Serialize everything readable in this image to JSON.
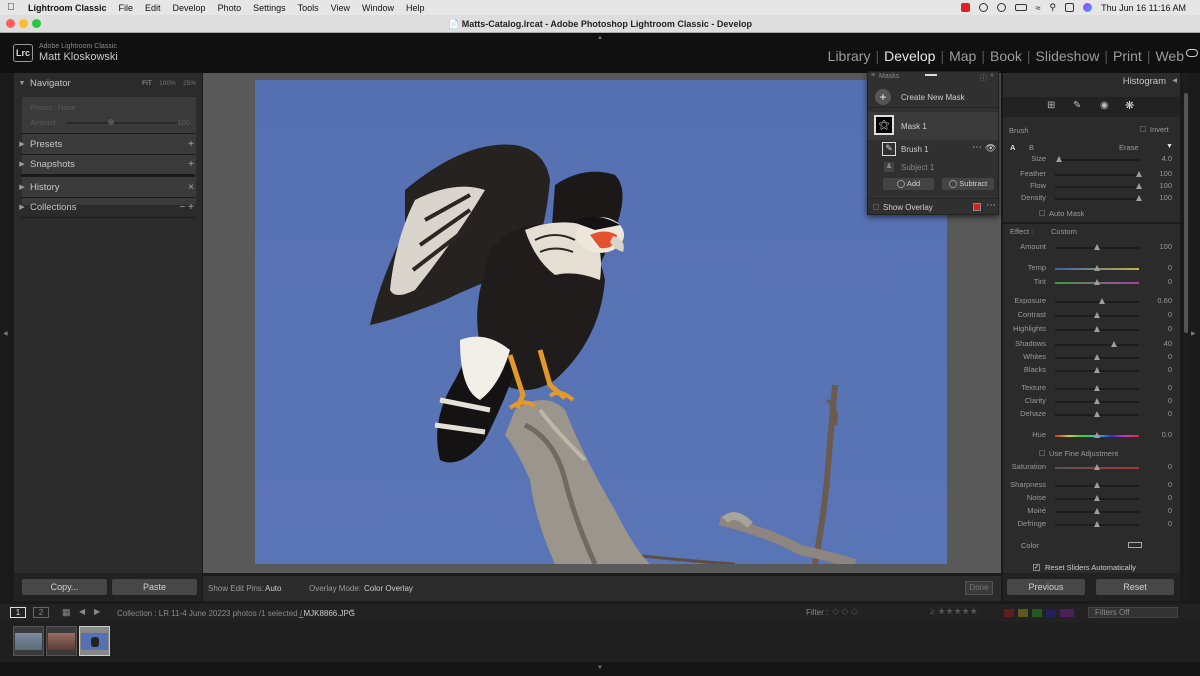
{
  "menubar": {
    "app": "Lightroom Classic",
    "items": [
      "File",
      "Edit",
      "Develop",
      "Photo",
      "Settings",
      "Tools",
      "View",
      "Window",
      "Help"
    ],
    "clock": "Thu Jun 16  11:16 AM"
  },
  "window": {
    "title": "Matts-Catalog.lrcat - Adobe Photoshop Lightroom Classic - Develop"
  },
  "identity": {
    "logo": "Lrc",
    "app_name": "Adobe Lightroom Classic",
    "user": "Matt Kloskowski"
  },
  "modules": [
    "Library",
    "Develop",
    "Map",
    "Book",
    "Slideshow",
    "Print",
    "Web"
  ],
  "active_module": "Develop",
  "left_panel": {
    "navigator": {
      "label": "Navigator",
      "zoom_opts": [
        "FIT",
        "100%",
        "25%"
      ]
    },
    "preset_preview": {
      "name": "Preset : None",
      "amount_label": "Amount",
      "amount_value": "100"
    },
    "sections": [
      {
        "label": "Presets",
        "action": "+"
      },
      {
        "label": "Snapshots",
        "action": "+"
      },
      {
        "label": "History",
        "action": "×"
      },
      {
        "label": "Collections",
        "action": "− +"
      }
    ],
    "copy_label": "Copy...",
    "paste_label": "Paste"
  },
  "masks_panel": {
    "title": "Masks",
    "create_label": "Create New Mask",
    "mask_name": "Mask 1",
    "brush_name": "Brush 1",
    "subject_name": "Subject 1",
    "add_label": "Add",
    "subtract_label": "Subtract",
    "show_overlay_label": "Show Overlay",
    "overlay_color": "#d42020"
  },
  "toolbar": {
    "edit_pins_label": "Show Edit Pins:",
    "edit_pins_value": "Auto",
    "overlay_mode_label": "Overlay Mode:",
    "overlay_mode_value": "Color Overlay",
    "done_label": "Done"
  },
  "right_panel": {
    "histogram_label": "Histogram",
    "brush": {
      "label": "Brush",
      "invert_label": "Invert",
      "tab_a": "A",
      "tab_b": "B",
      "erase_label": "Erase",
      "auto_mask_label": "Auto Mask",
      "sliders": [
        {
          "label": "Size",
          "value": "4.0",
          "pos": 0.05
        },
        {
          "label": "Feather",
          "value": "100",
          "pos": 1.0
        },
        {
          "label": "Flow",
          "value": "100",
          "pos": 1.0
        },
        {
          "label": "Density",
          "value": "100",
          "pos": 1.0
        }
      ]
    },
    "effect": {
      "label": "Effect :",
      "preset": "Custom",
      "amount": {
        "label": "Amount",
        "value": "100",
        "pos": 0.5
      },
      "sliders": [
        {
          "label": "Temp",
          "value": "0",
          "pos": 0.5,
          "kind": "temp"
        },
        {
          "label": "Tint",
          "value": "0",
          "pos": 0.5,
          "kind": "tint"
        },
        {
          "label": "Exposure",
          "value": "0.60",
          "pos": 0.56
        },
        {
          "label": "Contrast",
          "value": "0",
          "pos": 0.5
        },
        {
          "label": "Highlights",
          "value": "0",
          "pos": 0.5
        },
        {
          "label": "Shadows",
          "value": "40",
          "pos": 0.7
        },
        {
          "label": "Whites",
          "value": "0",
          "pos": 0.5
        },
        {
          "label": "Blacks",
          "value": "0",
          "pos": 0.5
        },
        {
          "label": "Texture",
          "value": "0",
          "pos": 0.5
        },
        {
          "label": "Clarity",
          "value": "0",
          "pos": 0.5
        },
        {
          "label": "Dehaze",
          "value": "0",
          "pos": 0.5
        },
        {
          "label": "Hue",
          "value": "0.0",
          "pos": 0.5,
          "kind": "hue"
        },
        {
          "label": "Saturation",
          "value": "0",
          "pos": 0.5,
          "kind": "sat"
        },
        {
          "label": "Sharpness",
          "value": "0",
          "pos": 0.5
        },
        {
          "label": "Noise",
          "value": "0",
          "pos": 0.5
        },
        {
          "label": "Moiré",
          "value": "0",
          "pos": 0.5
        },
        {
          "label": "Defringe",
          "value": "0",
          "pos": 0.5
        }
      ],
      "fine_adjust_label": "Use Fine Adjustment",
      "color_label": "Color",
      "reset_label": "Reset Sliders Automatically"
    },
    "previous_label": "Previous",
    "reset_button": "Reset"
  },
  "filmstrip": {
    "page1": "1",
    "page2": "2",
    "source": "Collection : LR 11-4 June 2022",
    "count": "3 photos /1 selected /",
    "filename": "_MJK8866.JPG",
    "filter_label": "Filter :",
    "filter_value": "Filters Off"
  }
}
